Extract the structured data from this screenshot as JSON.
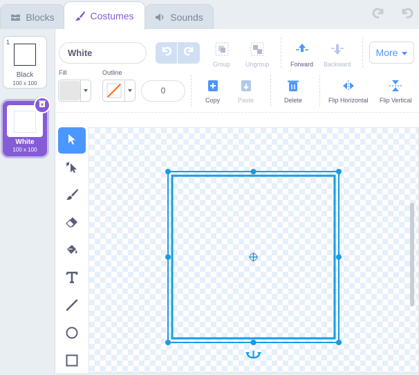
{
  "tabs": [
    {
      "label": "Blocks",
      "icon": "blocks-icon"
    },
    {
      "label": "Costumes",
      "icon": "brush-icon",
      "active": true
    },
    {
      "label": "Sounds",
      "icon": "speaker-icon"
    }
  ],
  "costumes": [
    {
      "number": "1",
      "name": "Black",
      "size": "100 x 100"
    },
    {
      "number": "2",
      "name": "White",
      "size": "100 x 100",
      "selected": true
    }
  ],
  "editor": {
    "costume_name": "White",
    "group_label": "Group",
    "ungroup_label": "Ungroup",
    "forward_label": "Forward",
    "backward_label": "Backward",
    "more_label": "More",
    "fill_label": "Fill",
    "outline_label": "Outline",
    "outline_width": "0",
    "copy_label": "Copy",
    "paste_label": "Paste",
    "delete_label": "Delete",
    "flip_h_label": "Flip Horizontal",
    "flip_v_label": "Flip Vertical"
  },
  "colors": {
    "accent": "#4c97ff",
    "costume_purple": "#855cd6",
    "fill_swatch": "#e6e6e6",
    "outline_slash": "#ff6600"
  }
}
